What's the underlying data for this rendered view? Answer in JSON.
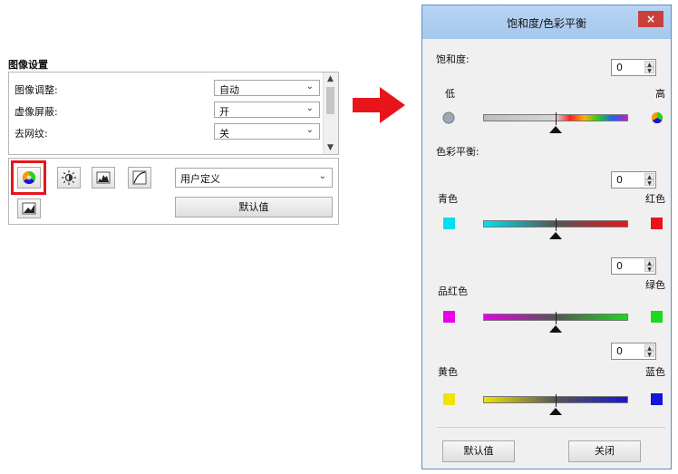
{
  "left_panel": {
    "title": "图像设置",
    "settings": [
      {
        "label": "图像调整:",
        "value": "自动"
      },
      {
        "label": "虚像屏蔽:",
        "value": "开"
      },
      {
        "label": "去网纹:",
        "value": "关"
      }
    ],
    "preset_value": "用户定义",
    "default_button": "默认值"
  },
  "dialog": {
    "title": "饱和度/色彩平衡",
    "close_symbol": "×",
    "saturation": {
      "label": "饱和度:",
      "value": "0",
      "low_label": "低",
      "high_label": "高"
    },
    "color_balance_label": "色彩平衡:",
    "balances": [
      {
        "left": "青色",
        "right": "红色",
        "value": "0",
        "left_color": "#00e0ee",
        "right_color": "#e8141c"
      },
      {
        "left": "品红色",
        "right": "绿色",
        "value": "0",
        "left_color": "#e800e8",
        "right_color": "#1ed81e"
      },
      {
        "left": "黄色",
        "right": "蓝色",
        "value": "0",
        "left_color": "#f0e400",
        "right_color": "#1616d8"
      }
    ],
    "default_button": "默认值",
    "close_button": "关闭"
  },
  "colors": {
    "highlight": "#e8141c",
    "arrow": "#e8141c",
    "titlebar": "#b7d4f2"
  }
}
